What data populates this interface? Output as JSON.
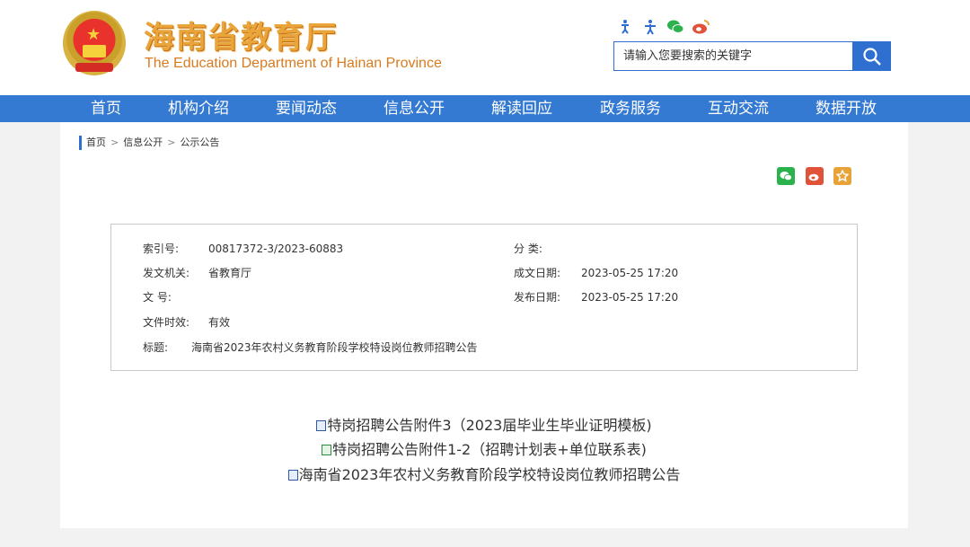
{
  "header": {
    "cn_title": "海南省教育厅",
    "en_title": "The Education Department of Hainan Province",
    "icons": [
      "accessibility-icon",
      "elder-care-icon",
      "wechat-icon",
      "weibo-icon"
    ],
    "search": {
      "placeholder": "请输入您要搜索的关键字",
      "button_icon": "search-icon"
    }
  },
  "nav": {
    "items": [
      "首页",
      "机构介绍",
      "要闻动态",
      "信息公开",
      "解读回应",
      "政务服务",
      "互动交流",
      "数据开放"
    ]
  },
  "breadcrumb": {
    "items": [
      "首页",
      "信息公开",
      "公示公告"
    ],
    "separator": ">"
  },
  "share": [
    "wechat-share-icon",
    "weibo-share-icon",
    "favorite-icon"
  ],
  "info": {
    "index_no": {
      "label": "索引号:",
      "value": "00817372-3/2023-60883"
    },
    "category": {
      "label": "分 类:",
      "value": ""
    },
    "issuer": {
      "label": "发文机关:",
      "value": "省教育厅"
    },
    "written_date": {
      "label": "成文日期:",
      "value": "2023-05-25 17:20"
    },
    "doc_no": {
      "label": "文 号:",
      "value": ""
    },
    "publish_date": {
      "label": "发布日期:",
      "value": "2023-05-25 17:20"
    },
    "validity": {
      "label": "文件时效:",
      "value": "有效"
    },
    "title": {
      "label": "标题:",
      "value": "海南省2023年农村义务教育阶段学校特设岗位教师招聘公告"
    }
  },
  "attachments": [
    {
      "text": "特岗招聘公告附件3（2023届毕业生毕业证明模板)",
      "type": "doc"
    },
    {
      "text": "特岗招聘公告附件1-2（招聘计划表+单位联系表)",
      "type": "xls"
    },
    {
      "text": "海南省2023年农村义务教育阶段学校特设岗位教师招聘公告",
      "type": "doc"
    }
  ],
  "colors": {
    "nav_blue": "#3479d2",
    "title_orange": "#e9a53a",
    "wechat_green": "#2bb24c",
    "weibo_red": "#e0533a",
    "favorite_orange": "#e8a23a"
  }
}
